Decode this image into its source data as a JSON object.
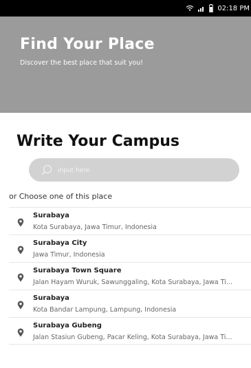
{
  "status_bar": {
    "time": "02:18 PM"
  },
  "header": {
    "title": "Find Your Place",
    "subtitle": "Discover the best place that suit you!"
  },
  "main": {
    "section_title": "Write Your Campus",
    "search": {
      "placeholder": "input here",
      "value": ""
    },
    "choose_label": "or Choose one of this place",
    "places": [
      {
        "name": "Surabaya",
        "address": "Kota Surabaya, Jawa Timur, Indonesia"
      },
      {
        "name": "Surabaya City",
        "address": "Jawa Timur, Indonesia"
      },
      {
        "name": "Surabaya Town Square",
        "address": "Jalan Hayam Wuruk, Sawunggaling, Kota Surabaya, Jawa Ti..."
      },
      {
        "name": "Surabaya",
        "address": "Kota Bandar Lampung, Lampung, Indonesia"
      },
      {
        "name": "Surabaya Gubeng",
        "address": "Jalan Stasiun Gubeng, Pacar Keling, Kota Surabaya, Jawa Ti..."
      }
    ]
  },
  "colors": {
    "header_bg": "#9b9b9b",
    "search_bg": "#d2d2d2",
    "status_bar_bg": "#000000"
  }
}
